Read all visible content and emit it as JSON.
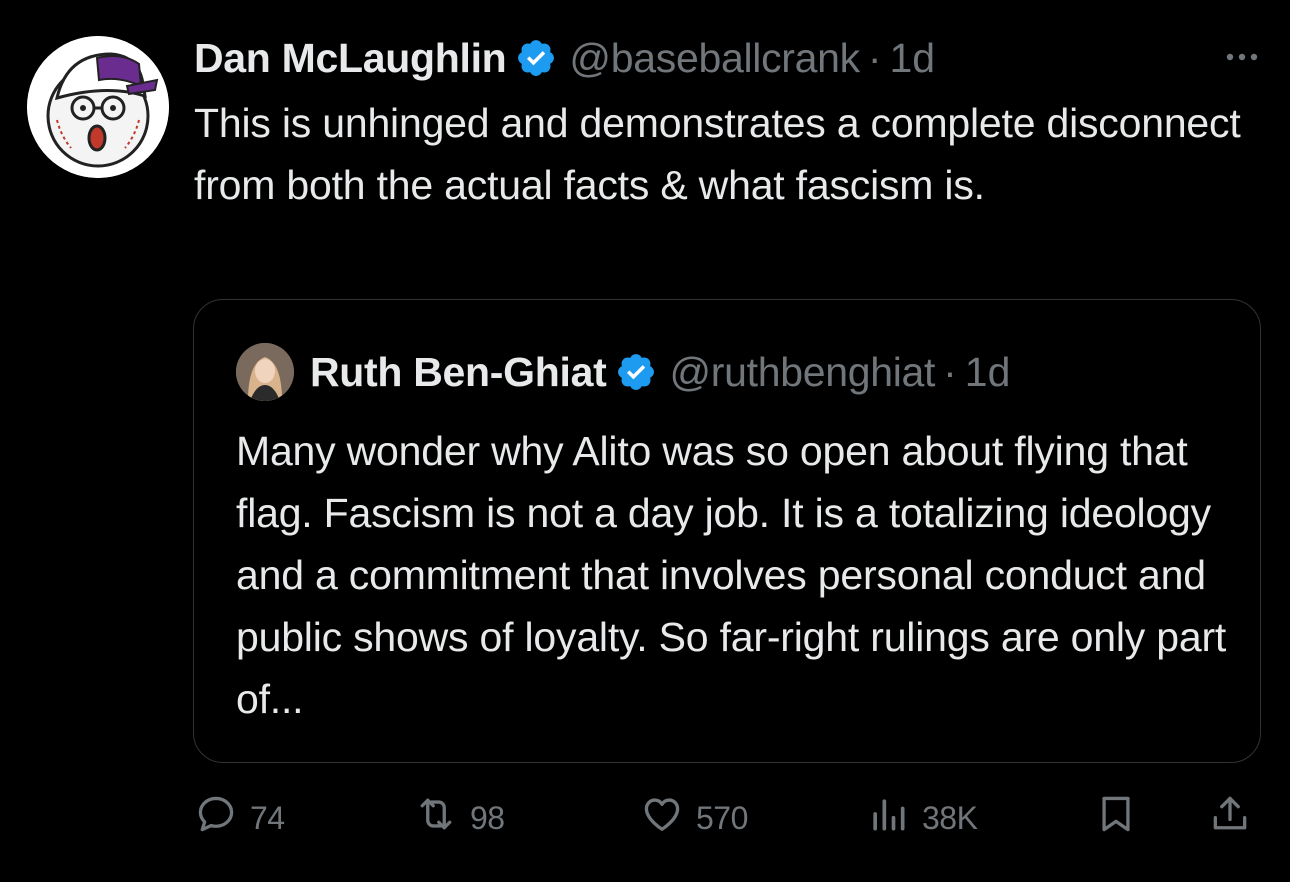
{
  "tweet": {
    "author": {
      "display_name": "Dan McLaughlin",
      "handle": "@baseballcrank",
      "verified": true
    },
    "separator": "·",
    "time": "1d",
    "text": "This is unhinged and demonstrates a complete disconnect from both the actual facts & what fascism is."
  },
  "quote": {
    "author": {
      "display_name": "Ruth Ben-Ghiat",
      "handle": "@ruthbenghiat",
      "verified": true
    },
    "separator": "·",
    "time": "1d",
    "text": "Many wonder why Alito was so open about flying that flag. Fascism is not a day job. It is a totalizing ideology and a commitment that involves personal conduct and public shows of loyalty. So far-right rulings are only part of..."
  },
  "actions": {
    "replies": "74",
    "reposts": "98",
    "likes": "570",
    "views": "38K"
  },
  "icons": {
    "more": "more-horizontal-icon",
    "verified": "verified-badge-icon",
    "reply": "reply-icon",
    "repost": "repost-icon",
    "like": "heart-icon",
    "views": "views-chart-icon",
    "bookmark": "bookmark-icon",
    "share": "share-icon"
  },
  "colors": {
    "background": "#000000",
    "text_primary": "#e7e9ea",
    "text_secondary": "#71767b",
    "border": "#2f3336",
    "verified_blue": "#1d9bf0"
  }
}
